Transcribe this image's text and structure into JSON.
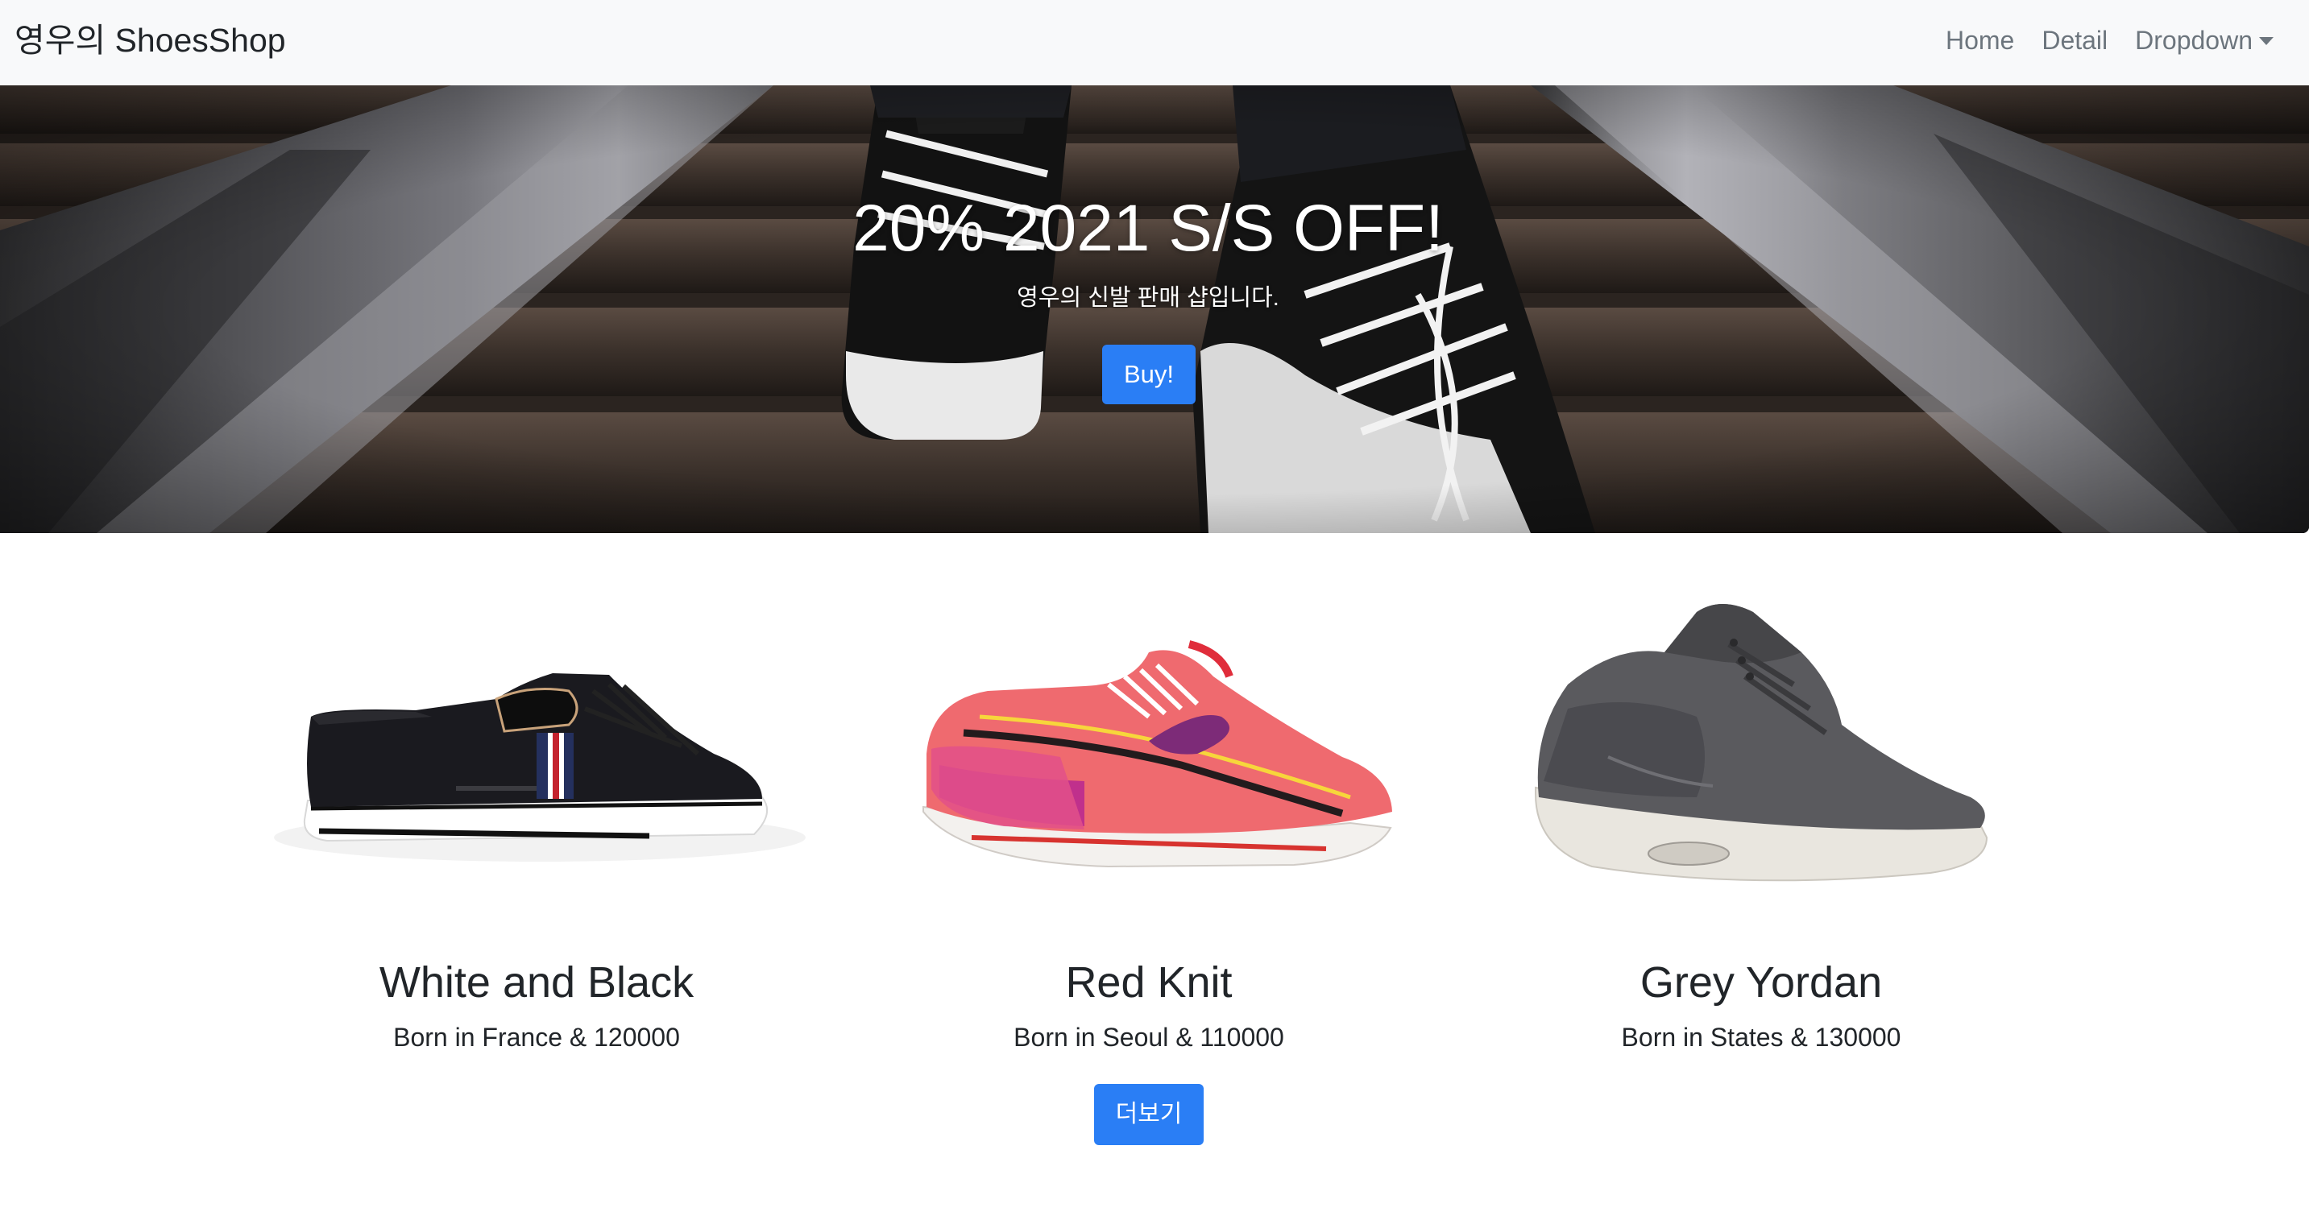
{
  "navbar": {
    "brand": "영우의 ShoesShop",
    "links": [
      {
        "label": "Home"
      },
      {
        "label": "Detail"
      },
      {
        "label": "Dropdown"
      }
    ]
  },
  "hero": {
    "title": "20% 2021 S/S OFF!",
    "subtitle": "영우의 신발 판매 샵입니다.",
    "button_label": "Buy!"
  },
  "products": [
    {
      "name": "White and Black",
      "description": "Born in France & 120000"
    },
    {
      "name": "Red Knit",
      "description": "Born in Seoul & 110000"
    },
    {
      "name": "Grey Yordan",
      "description": "Born in States & 130000"
    }
  ],
  "more_button_label": "더보기",
  "colors": {
    "primary": "#2a7ef5",
    "navbar_bg": "#f8f9fa",
    "nav_link": "#6c757d",
    "text": "#212529"
  }
}
